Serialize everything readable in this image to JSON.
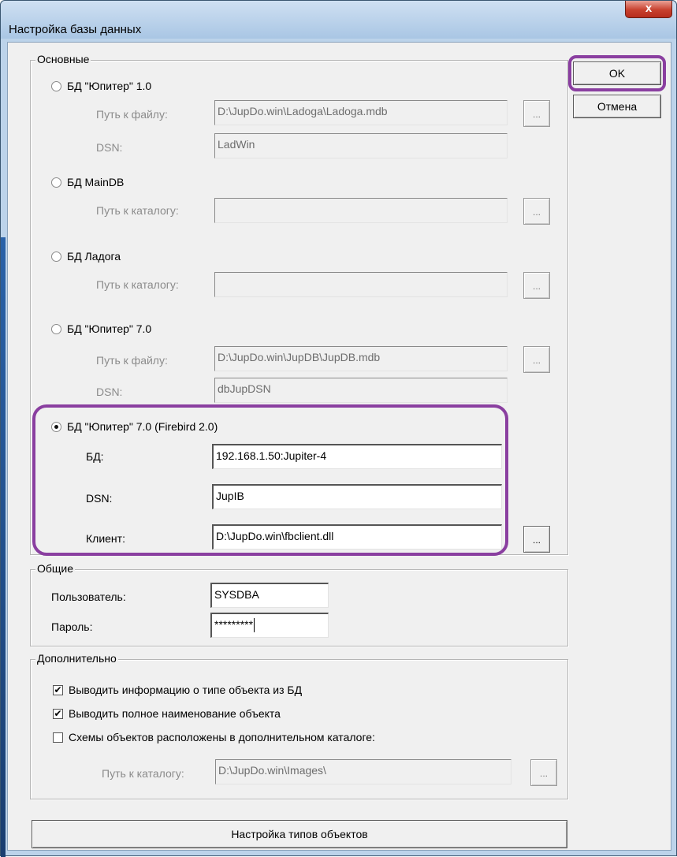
{
  "window": {
    "title": "Настройка базы данных",
    "close_glyph": "x"
  },
  "buttons": {
    "ok": "OK",
    "cancel": "Отмена",
    "object_types": "Настройка типов объектов"
  },
  "main_group": {
    "legend": "Основные",
    "jupiter1": {
      "label": "БД \"Юпитер\" 1.0",
      "path_label": "Путь к файлу:",
      "path_value": "D:\\JupDo.win\\Ladoga\\Ladoga.mdb",
      "dsn_label": "DSN:",
      "dsn_value": "LadWin"
    },
    "maindb": {
      "label": "БД MainDB",
      "path_label": "Путь к каталогу:",
      "path_value": ""
    },
    "ladoga": {
      "label": "БД Ладога",
      "path_label": "Путь к каталогу:",
      "path_value": ""
    },
    "jupiter7": {
      "label": "БД \"Юпитер\" 7.0",
      "path_label": "Путь к файлу:",
      "path_value": "D:\\JupDo.win\\JupDB\\JupDB.mdb",
      "dsn_label": "DSN:",
      "dsn_value": "dbJupDSN"
    },
    "firebird": {
      "label": "БД \"Юпитер\" 7.0 (Firebird 2.0)",
      "db_label": "БД:",
      "db_value": "192.168.1.50:Jupiter-4",
      "dsn_label": "DSN:",
      "dsn_value": "JupIB",
      "client_label": "Клиент:",
      "client_value": "D:\\JupDo.win\\fbclient.dll"
    },
    "browse": "..."
  },
  "common_group": {
    "legend": "Общие",
    "user_label": "Пользователь:",
    "user_value": "SYSDBA",
    "password_label": "Пароль:",
    "password_value": "*********"
  },
  "extra_group": {
    "legend": "Дополнительно",
    "check1": {
      "label": "Выводить информацию о типе объекта из БД",
      "checked": true,
      "mark": "✔"
    },
    "check2": {
      "label": "Выводить полное наименование объекта",
      "checked": true,
      "mark": "✔"
    },
    "check3": {
      "label": "Схемы объектов расположены в дополнительном каталоге:",
      "checked": false,
      "mark": ""
    },
    "path_label": "Путь к каталогу:",
    "path_value": "D:\\JupDo.win\\Images\\"
  },
  "selected_option": "firebird",
  "colors": {
    "highlight": "#8a3fa0",
    "window_frame": "#bcd3ea",
    "dialog_bg": "#f0f0f0",
    "close_button": "#c8412f"
  }
}
